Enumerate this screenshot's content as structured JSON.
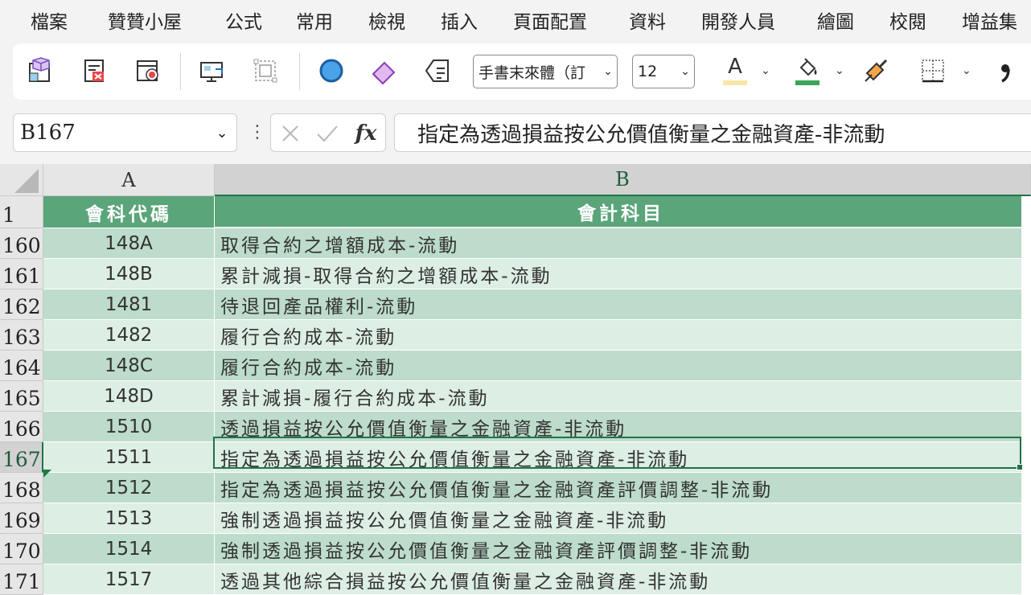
{
  "menu": [
    "檔案",
    "贊贊小屋",
    "公式",
    "常用",
    "檢視",
    "插入",
    "頁面配置",
    "資料",
    "開發人員",
    "繪圖",
    "校閱",
    "增益集"
  ],
  "ribbon": {
    "font_name": "手書末來體（訂",
    "font_size": "12",
    "font_color_label": "A",
    "colors": {
      "font_underline": "#f7e7a6",
      "fill_underline": "#3aa55a",
      "accent": "#217346"
    }
  },
  "formula_bar": {
    "name_box": "B167",
    "fx_label": "fx",
    "formula": "指定為透過損益按公允價值衡量之金融資產-非流動"
  },
  "sheet": {
    "columns": [
      "A",
      "B"
    ],
    "header_row": {
      "row_number": "1",
      "a": "會科代碼",
      "b": "會計科目"
    },
    "rows": [
      {
        "row_number": "160",
        "a": "148A",
        "b": "取得合約之增額成本-流動"
      },
      {
        "row_number": "161",
        "a": "148B",
        "b": "累計減損-取得合約之增額成本-流動"
      },
      {
        "row_number": "162",
        "a": "1481",
        "b": "待退回產品權利-流動"
      },
      {
        "row_number": "163",
        "a": "1482",
        "b": "履行合約成本-流動"
      },
      {
        "row_number": "164",
        "a": "148C",
        "b": "履行合約成本-流動"
      },
      {
        "row_number": "165",
        "a": "148D",
        "b": "累計減損-履行合約成本-流動"
      },
      {
        "row_number": "166",
        "a": "1510",
        "b": "透過損益按公允價值衡量之金融資產-非流動"
      },
      {
        "row_number": "167",
        "a": "1511",
        "b": "指定為透過損益按公允價值衡量之金融資產-非流動"
      },
      {
        "row_number": "168",
        "a": "1512",
        "b": "指定為透過損益按公允價值衡量之金融資產評價調整-非流動"
      },
      {
        "row_number": "169",
        "a": "1513",
        "b": "強制透過損益按公允價值衡量之金融資產-非流動"
      },
      {
        "row_number": "170",
        "a": "1514",
        "b": "強制透過損益按公允價值衡量之金融資產評價調整-非流動"
      },
      {
        "row_number": "171",
        "a": "1517",
        "b": "透過其他綜合損益按公允價值衡量之金融資產-非流動"
      }
    ],
    "active_row_number": "167"
  }
}
